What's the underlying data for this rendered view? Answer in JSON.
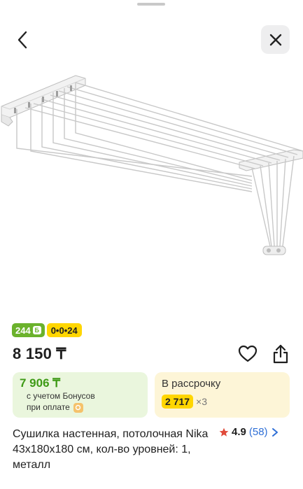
{
  "product": {
    "badges": {
      "bonus": "244",
      "bonus_icon": "Б",
      "installment": "0•0•24"
    },
    "price": "8 150 ₸",
    "bonus_card": {
      "amount": "7 906 ₸",
      "line1": "с учетом Бонусов",
      "line2": "при оплате"
    },
    "installment_card": {
      "title": "В рассрочку",
      "amount": "2 717",
      "times": "×3"
    },
    "title": "Сушилка настенная, потолочная Nika 43x180x180 см, кол-во уровней: 1, металл",
    "rating": {
      "value": "4.9",
      "count": "(58)"
    }
  },
  "colors": {
    "accent_green": "#6bb22c",
    "accent_yellow": "#ffd600",
    "link_blue": "#2f6fd6",
    "star_red": "#e04a3a"
  },
  "icons": [
    "back-arrow-icon",
    "close-icon",
    "heart-icon",
    "share-icon",
    "star-icon",
    "chevron-right-icon"
  ]
}
